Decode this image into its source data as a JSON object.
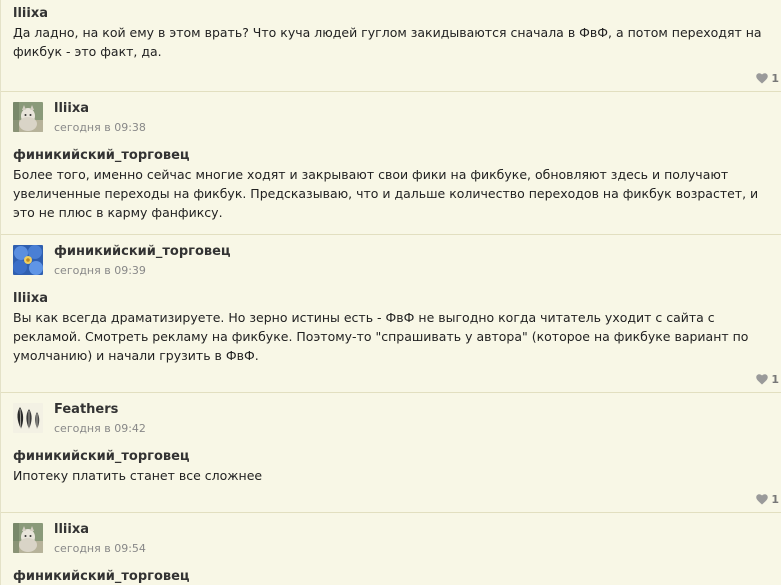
{
  "colors": {
    "background": "#f7f6e4",
    "divider": "#e2dfc0",
    "author_text": "#333333",
    "time_text": "#888888",
    "heart": "#9a9a9a"
  },
  "comments": [
    {
      "partial_top": true,
      "quote_author": "lliixa",
      "text": "Да ладно, на кой ему в этом врать? Что куча людей гуглом закидываются сначала в ФвФ, а потом переходят на фикбук - это факт, да.",
      "likes": "1"
    },
    {
      "author": "lliixa",
      "avatar_icon": "cat-photo-avatar-icon",
      "time": "сегодня в 09:38",
      "quote_author": "финикийский_торговец",
      "text": "Более того, именно сейчас многие ходят и закрывают свои фики на фикбуке, обновляют здесь и получают увеличенные переходы на фикбук. Предсказываю, что и дальше количество переходов на фикбук возрастет, и это не плюс в карму фанфиксу.",
      "likes": ""
    },
    {
      "author": "финикийский_торговец",
      "avatar_icon": "blue-flower-avatar-icon",
      "time": "сегодня в 09:39",
      "quote_author": "lliixa",
      "text": "Вы как всегда драматизируете. Но зерно истины есть - ФвФ не выгодно когда читатель уходит с сайта с рекламой. Смотреть рекламу на фикбуке. Поэтому-то \"спрашивать у автора\" (которое на фикбуке вариант по умолчанию) и начали грузить в ФвФ.",
      "likes": "1"
    },
    {
      "author": "Feathers",
      "avatar_icon": "feathers-avatar-icon",
      "time": "сегодня в 09:42",
      "quote_author": "финикийский_торговец",
      "text": "Ипотеку платить станет все сложнее",
      "likes": "1"
    },
    {
      "author": "lliixa",
      "avatar_icon": "cat-photo-avatar-icon",
      "time": "сегодня в 09:54",
      "quote_author": "финикийский_торговец",
      "text": "",
      "likes": ""
    }
  ]
}
